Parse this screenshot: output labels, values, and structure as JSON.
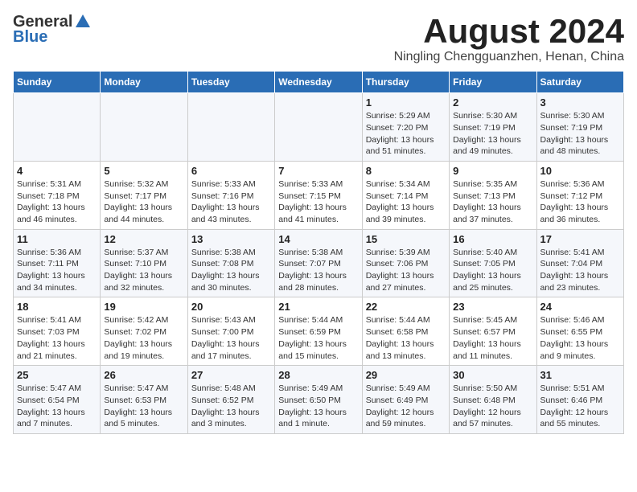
{
  "logo": {
    "general": "General",
    "blue": "Blue"
  },
  "title": {
    "month": "August 2024",
    "location": "Ningling Chengguanzhen, Henan, China"
  },
  "headers": [
    "Sunday",
    "Monday",
    "Tuesday",
    "Wednesday",
    "Thursday",
    "Friday",
    "Saturday"
  ],
  "weeks": [
    [
      {
        "day": "",
        "info": ""
      },
      {
        "day": "",
        "info": ""
      },
      {
        "day": "",
        "info": ""
      },
      {
        "day": "",
        "info": ""
      },
      {
        "day": "1",
        "info": "Sunrise: 5:29 AM\nSunset: 7:20 PM\nDaylight: 13 hours\nand 51 minutes."
      },
      {
        "day": "2",
        "info": "Sunrise: 5:30 AM\nSunset: 7:19 PM\nDaylight: 13 hours\nand 49 minutes."
      },
      {
        "day": "3",
        "info": "Sunrise: 5:30 AM\nSunset: 7:19 PM\nDaylight: 13 hours\nand 48 minutes."
      }
    ],
    [
      {
        "day": "4",
        "info": "Sunrise: 5:31 AM\nSunset: 7:18 PM\nDaylight: 13 hours\nand 46 minutes."
      },
      {
        "day": "5",
        "info": "Sunrise: 5:32 AM\nSunset: 7:17 PM\nDaylight: 13 hours\nand 44 minutes."
      },
      {
        "day": "6",
        "info": "Sunrise: 5:33 AM\nSunset: 7:16 PM\nDaylight: 13 hours\nand 43 minutes."
      },
      {
        "day": "7",
        "info": "Sunrise: 5:33 AM\nSunset: 7:15 PM\nDaylight: 13 hours\nand 41 minutes."
      },
      {
        "day": "8",
        "info": "Sunrise: 5:34 AM\nSunset: 7:14 PM\nDaylight: 13 hours\nand 39 minutes."
      },
      {
        "day": "9",
        "info": "Sunrise: 5:35 AM\nSunset: 7:13 PM\nDaylight: 13 hours\nand 37 minutes."
      },
      {
        "day": "10",
        "info": "Sunrise: 5:36 AM\nSunset: 7:12 PM\nDaylight: 13 hours\nand 36 minutes."
      }
    ],
    [
      {
        "day": "11",
        "info": "Sunrise: 5:36 AM\nSunset: 7:11 PM\nDaylight: 13 hours\nand 34 minutes."
      },
      {
        "day": "12",
        "info": "Sunrise: 5:37 AM\nSunset: 7:10 PM\nDaylight: 13 hours\nand 32 minutes."
      },
      {
        "day": "13",
        "info": "Sunrise: 5:38 AM\nSunset: 7:08 PM\nDaylight: 13 hours\nand 30 minutes."
      },
      {
        "day": "14",
        "info": "Sunrise: 5:38 AM\nSunset: 7:07 PM\nDaylight: 13 hours\nand 28 minutes."
      },
      {
        "day": "15",
        "info": "Sunrise: 5:39 AM\nSunset: 7:06 PM\nDaylight: 13 hours\nand 27 minutes."
      },
      {
        "day": "16",
        "info": "Sunrise: 5:40 AM\nSunset: 7:05 PM\nDaylight: 13 hours\nand 25 minutes."
      },
      {
        "day": "17",
        "info": "Sunrise: 5:41 AM\nSunset: 7:04 PM\nDaylight: 13 hours\nand 23 minutes."
      }
    ],
    [
      {
        "day": "18",
        "info": "Sunrise: 5:41 AM\nSunset: 7:03 PM\nDaylight: 13 hours\nand 21 minutes."
      },
      {
        "day": "19",
        "info": "Sunrise: 5:42 AM\nSunset: 7:02 PM\nDaylight: 13 hours\nand 19 minutes."
      },
      {
        "day": "20",
        "info": "Sunrise: 5:43 AM\nSunset: 7:00 PM\nDaylight: 13 hours\nand 17 minutes."
      },
      {
        "day": "21",
        "info": "Sunrise: 5:44 AM\nSunset: 6:59 PM\nDaylight: 13 hours\nand 15 minutes."
      },
      {
        "day": "22",
        "info": "Sunrise: 5:44 AM\nSunset: 6:58 PM\nDaylight: 13 hours\nand 13 minutes."
      },
      {
        "day": "23",
        "info": "Sunrise: 5:45 AM\nSunset: 6:57 PM\nDaylight: 13 hours\nand 11 minutes."
      },
      {
        "day": "24",
        "info": "Sunrise: 5:46 AM\nSunset: 6:55 PM\nDaylight: 13 hours\nand 9 minutes."
      }
    ],
    [
      {
        "day": "25",
        "info": "Sunrise: 5:47 AM\nSunset: 6:54 PM\nDaylight: 13 hours\nand 7 minutes."
      },
      {
        "day": "26",
        "info": "Sunrise: 5:47 AM\nSunset: 6:53 PM\nDaylight: 13 hours\nand 5 minutes."
      },
      {
        "day": "27",
        "info": "Sunrise: 5:48 AM\nSunset: 6:52 PM\nDaylight: 13 hours\nand 3 minutes."
      },
      {
        "day": "28",
        "info": "Sunrise: 5:49 AM\nSunset: 6:50 PM\nDaylight: 13 hours\nand 1 minute."
      },
      {
        "day": "29",
        "info": "Sunrise: 5:49 AM\nSunset: 6:49 PM\nDaylight: 12 hours\nand 59 minutes."
      },
      {
        "day": "30",
        "info": "Sunrise: 5:50 AM\nSunset: 6:48 PM\nDaylight: 12 hours\nand 57 minutes."
      },
      {
        "day": "31",
        "info": "Sunrise: 5:51 AM\nSunset: 6:46 PM\nDaylight: 12 hours\nand 55 minutes."
      }
    ]
  ]
}
